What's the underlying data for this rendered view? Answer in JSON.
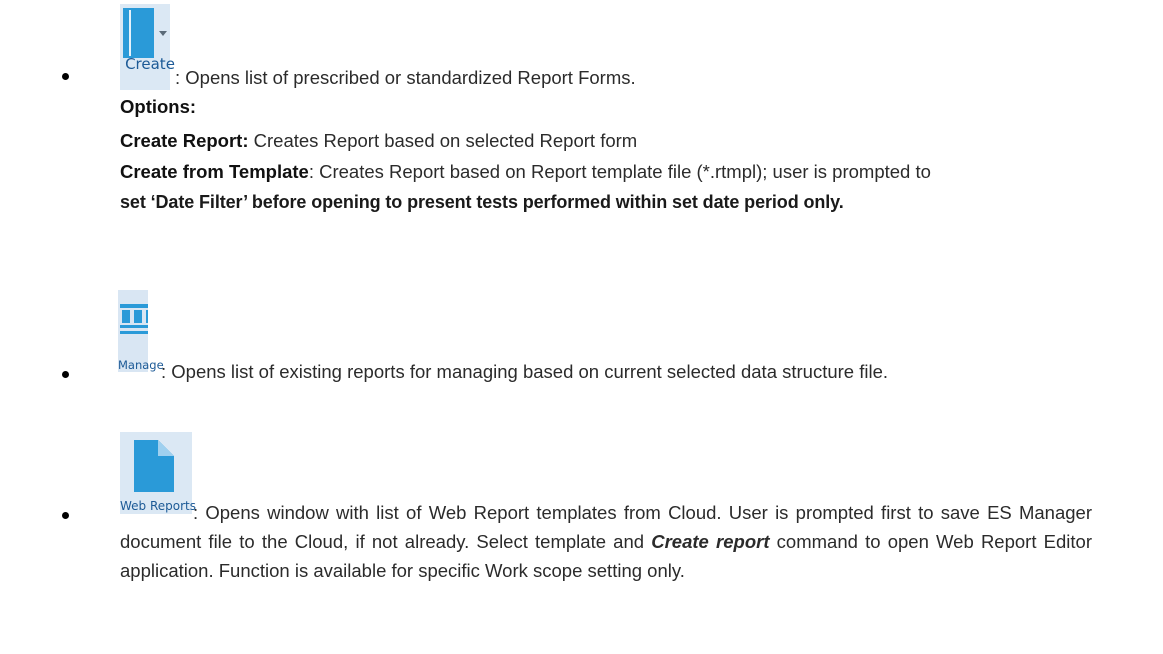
{
  "items": [
    {
      "button_label": "Create",
      "icon": "create-report-book-icon",
      "description": ": Opens list of prescribed or standardized Report Forms.",
      "options_heading": "Options:",
      "options": [
        {
          "term": "Create Report:",
          "text": " Creates Report based on selected Report form"
        },
        {
          "term": "Create from Template",
          "text": ": Creates Report based on Report template file (*.rtmpl); user is prompted to"
        }
      ],
      "continuation": "set ‘Date Filter’ before opening to present tests performed within set date period only."
    },
    {
      "button_label": "Manage",
      "icon": "manage-reports-icon",
      "description": ": Opens list of existing reports for managing based on current selected data structure file."
    },
    {
      "button_label": "Web Reports",
      "icon": "web-reports-document-icon",
      "description_before": ": Opens window with list of Web Report templates from Cloud. User is prompted first to save ES Manager document file to the Cloud, if not already. Select template and ",
      "description_emphasis": "Create report",
      "description_after": " command to open Web Report Editor application. Function is available for specific Work scope setting only."
    }
  ],
  "colors": {
    "button_background": "#dbe8f4",
    "icon_blue": "#2a9ad8",
    "label_blue": "#1c5a96"
  }
}
